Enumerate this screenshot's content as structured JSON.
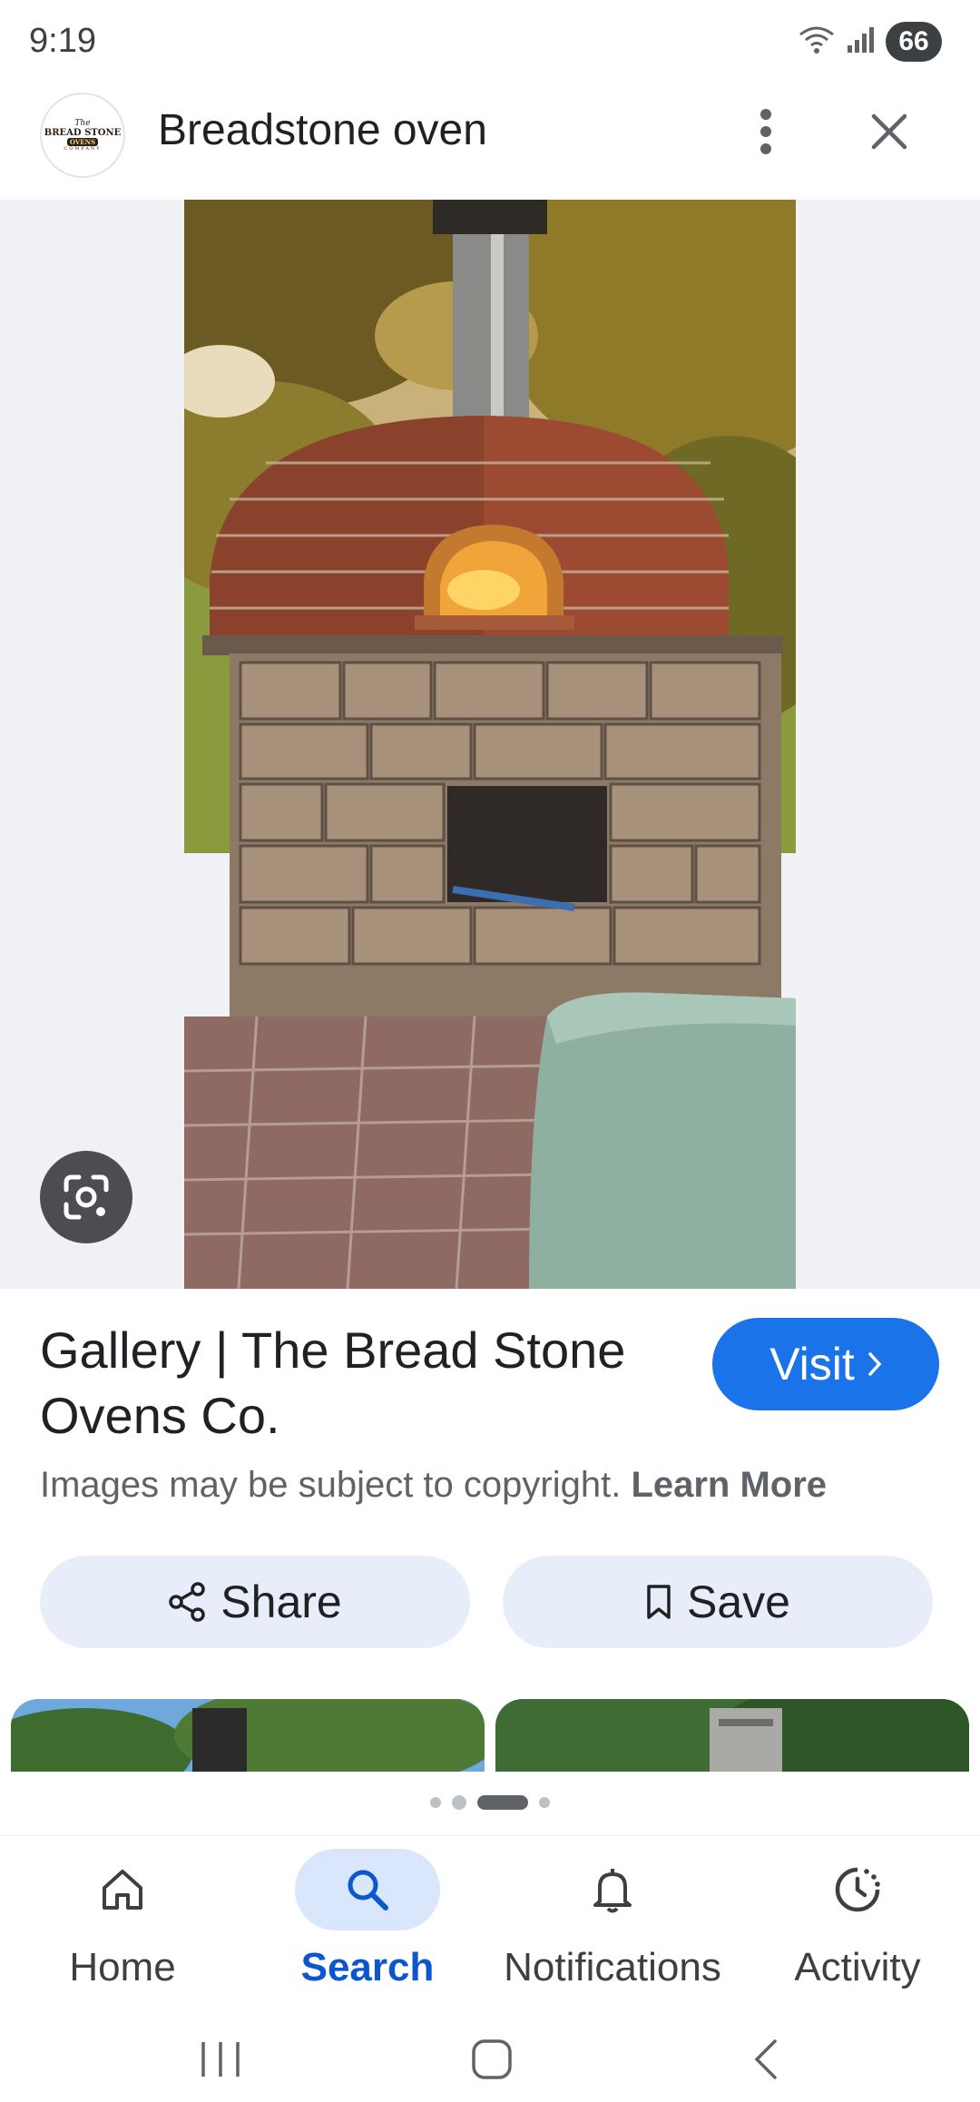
{
  "status_bar": {
    "time": "9:19",
    "battery": "66",
    "icons": [
      "wifi-icon",
      "signal-icon"
    ]
  },
  "header": {
    "site_logo": {
      "line1": "The",
      "line2": "BREAD STONE",
      "line3": "OVENS",
      "line4": "COMPANY"
    },
    "query": "Breadstone oven",
    "icons": [
      "more-vert-icon",
      "close-icon"
    ]
  },
  "result": {
    "title": "Gallery | The Bread Stone Ovens Co.",
    "visit_label": "Visit",
    "copyright_text": "Images may be subject to copyright.",
    "learn_more": "Learn More",
    "share_label": "Share",
    "save_label": "Save"
  },
  "carousel": {
    "dot_count": 4,
    "active_index": 2
  },
  "bottom_nav": {
    "items": [
      {
        "label": "Home",
        "icon": "home-icon",
        "active": false
      },
      {
        "label": "Search",
        "icon": "search-icon",
        "active": true
      },
      {
        "label": "Notifications",
        "icon": "bell-icon",
        "active": false
      },
      {
        "label": "Activity",
        "icon": "activity-icon",
        "active": false
      }
    ]
  },
  "system_nav": {
    "icons": [
      "recents-icon",
      "home-pill-icon",
      "back-icon"
    ]
  },
  "colors": {
    "accent": "#1a73e8",
    "active_nav": "#0b57d0",
    "chip_bg": "#e8eef9"
  }
}
